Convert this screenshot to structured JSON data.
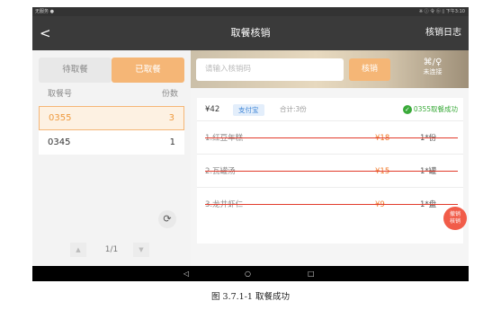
{
  "status_bar": {
    "left": "无服务 ●",
    "right": "※ ⓘ 令 ⓑ ▯ 下午3:10"
  },
  "header": {
    "back": "<",
    "title": "取餐核销",
    "log_label": "核销日志"
  },
  "tabs": [
    "待取餐",
    "已取餐"
  ],
  "list": {
    "col_number": "取餐号",
    "col_qty": "份数",
    "rows": [
      {
        "number": "0355",
        "qty": "3"
      },
      {
        "number": "0345",
        "qty": "1"
      }
    ]
  },
  "refresh_icon": "⟳",
  "pager": {
    "prev": "▲",
    "page": "1/1",
    "next": "▼"
  },
  "search": {
    "placeholder": "请输入核销码",
    "verify_label": "核销"
  },
  "connection": {
    "icon": "⌘/♀",
    "status": "未连接"
  },
  "order": {
    "amount": "¥42",
    "payment": "支付宝",
    "total": "合计:3份",
    "success_icon": "✓",
    "status": "0355取餐成功",
    "items": [
      {
        "name": "1.红豆年糕",
        "price": "¥18",
        "unit": "1*份"
      },
      {
        "name": "2.瓦罐汤",
        "price": "¥15",
        "unit": "1*罐"
      },
      {
        "name": "3.龙井虾仁",
        "price": "¥9",
        "unit": "1*盘"
      }
    ]
  },
  "cancel_button": {
    "line1": "撤销",
    "line2": "核销"
  },
  "nav": {
    "back": "◁",
    "home": "○",
    "recent": "□"
  },
  "caption": "图 3.7.1-1 取餐成功",
  "colors": {
    "accent": "#f5b676",
    "success": "#3aaa3a",
    "price": "#f07a2a",
    "cancel": "#f15c49"
  }
}
